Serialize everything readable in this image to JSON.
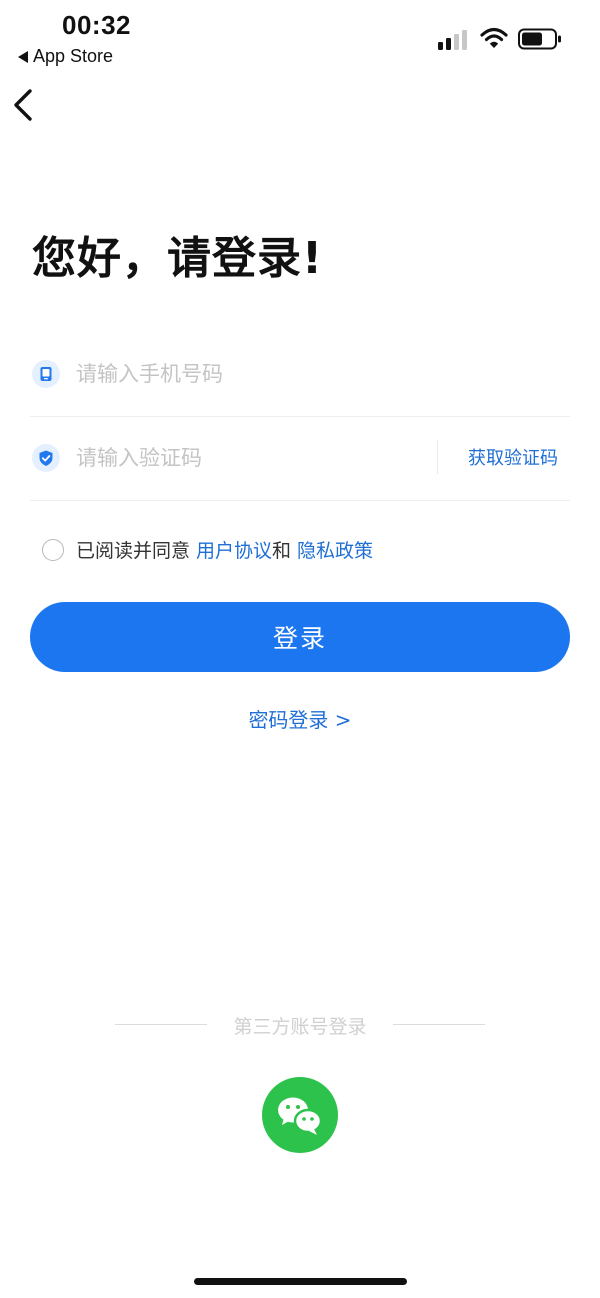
{
  "status_bar": {
    "time": "00:32",
    "back_app": "App Store"
  },
  "nav": {
    "back_icon": "chevron-left-icon"
  },
  "page": {
    "title": "您好，请登录!"
  },
  "form": {
    "phone_placeholder": "请输入手机号码",
    "phone_icon": "phone-icon",
    "code_placeholder": "请输入验证码",
    "code_icon": "shield-check-icon",
    "get_code_label": "获取验证码"
  },
  "agreement": {
    "prefix": "已阅读并同意",
    "user_agreement": "用户协议",
    "and": "和",
    "privacy_policy": "隐私政策"
  },
  "actions": {
    "login_label": "登录",
    "password_login_label": "密码登录 >"
  },
  "third_party": {
    "label": "第三方账号登录",
    "wechat_icon": "wechat-icon"
  },
  "colors": {
    "primary": "#1c76f0",
    "link": "#1f6fd6",
    "wechat": "#2dc24c"
  }
}
